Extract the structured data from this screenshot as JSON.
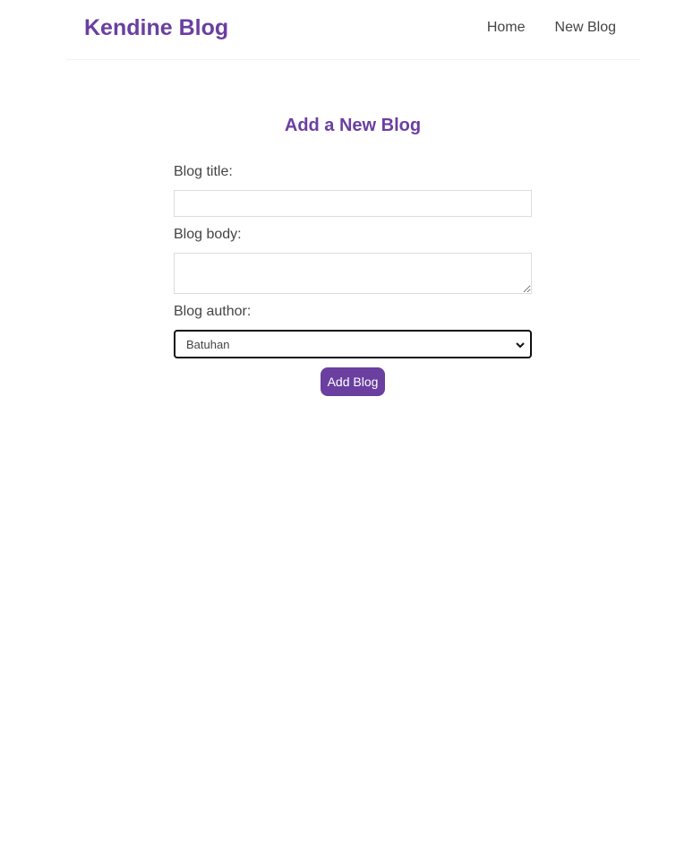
{
  "navbar": {
    "brand": "Kendine Blog",
    "links": [
      {
        "label": "Home"
      },
      {
        "label": "New Blog"
      }
    ]
  },
  "form": {
    "heading": "Add a New Blog",
    "title_label": "Blog title:",
    "title_value": "",
    "body_label": "Blog body:",
    "body_value": "",
    "author_label": "Blog author:",
    "author_selected": "Batuhan",
    "submit_label": "Add Blog"
  },
  "colors": {
    "accent": "#6a3fa0"
  }
}
